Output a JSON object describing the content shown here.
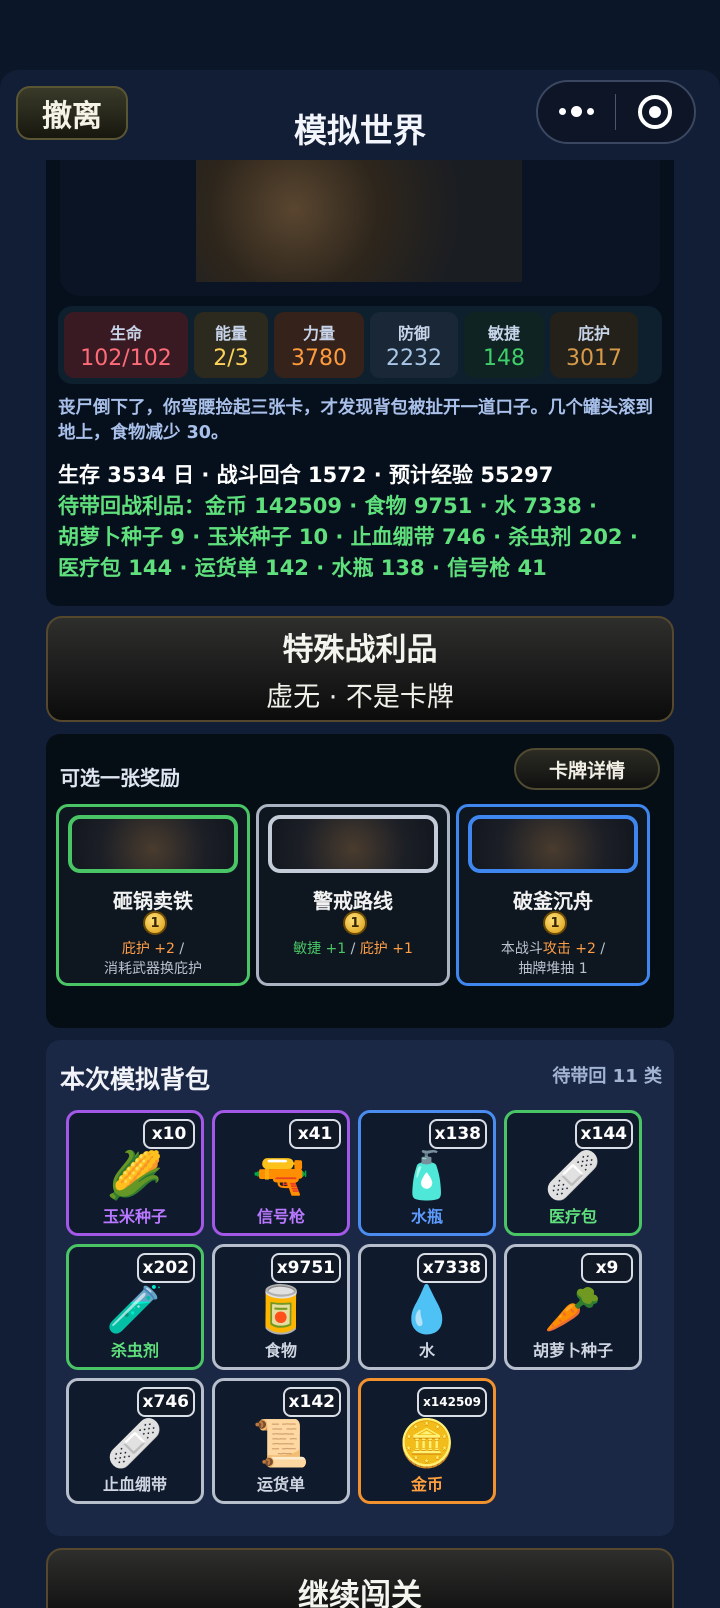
{
  "header": {
    "back_label": "撤离",
    "title": "模拟世界"
  },
  "stats": [
    {
      "label": "生命",
      "value": "102/102"
    },
    {
      "label": "能量",
      "value": "2/3"
    },
    {
      "label": "力量",
      "value": "3780"
    },
    {
      "label": "防御",
      "value": "2232"
    },
    {
      "label": "敏捷",
      "value": "148"
    },
    {
      "label": "庇护",
      "value": "3017"
    }
  ],
  "narration": "丧尸倒下了，你弯腰捡起三张卡，才发现背包被扯开一道口子。几个罐头滚到地上，食物减少 30。",
  "survival": {
    "summary": "生存 3534 日 · 战斗回合 1572 · 预计经验 55297",
    "loot_line1": "待带回战利品：金币 142509 · 食物 9751 · 水 7338 ·",
    "loot_line2": "胡萝卜种子 9 · 玉米种子 10 · 止血绷带 746 · 杀虫剂 202 ·",
    "loot_line3": "医疗包 144 · 运货单 142 · 水瓶 138 · 信号枪 41"
  },
  "special": {
    "title": "特殊战利品",
    "subtitle": "虚无 · 不是卡牌"
  },
  "rewards": {
    "title": "可选一张奖励",
    "detail_button": "卡牌详情",
    "cards": [
      {
        "name": "砸锅卖铁",
        "cost": "1",
        "desc_a": "庇护 +2",
        "desc_b": " / ",
        "desc_c": "消耗武器换庇护"
      },
      {
        "name": "警戒路线",
        "cost": "1",
        "desc_a": "敏捷 +1",
        "desc_b": " / ",
        "desc_c": "庇护 +1"
      },
      {
        "name": "破釜沉舟",
        "cost": "1",
        "desc_a": "本战斗",
        "desc_b": "攻击 +2",
        "desc_c": " / ",
        "desc_d": "抽牌堆抽 1"
      }
    ]
  },
  "bag": {
    "title": "本次模拟背包",
    "count": "待带回 11 类",
    "items": [
      {
        "name": "玉米种子",
        "qty": "x10",
        "icon": "corn-seed-bag-icon",
        "glyph": "🌽"
      },
      {
        "name": "信号枪",
        "qty": "x41",
        "icon": "flare-gun-icon",
        "glyph": "🔫"
      },
      {
        "name": "水瓶",
        "qty": "x138",
        "icon": "water-bottle-icon",
        "glyph": "🧴"
      },
      {
        "name": "医疗包",
        "qty": "x144",
        "icon": "medkit-icon",
        "glyph": "🩹"
      },
      {
        "name": "杀虫剂",
        "qty": "x202",
        "icon": "spray-bottle-icon",
        "glyph": "🧪"
      },
      {
        "name": "食物",
        "qty": "x9751",
        "icon": "canned-food-icon",
        "glyph": "🥫"
      },
      {
        "name": "水",
        "qty": "x7338",
        "icon": "water-drop-icon",
        "glyph": "💧"
      },
      {
        "name": "胡萝卜种子",
        "qty": "x9",
        "icon": "carrot-seed-bag-icon",
        "glyph": "🥕"
      },
      {
        "name": "止血绷带",
        "qty": "x746",
        "icon": "bandage-roll-icon",
        "glyph": "🩹"
      },
      {
        "name": "运货单",
        "qty": "x142",
        "icon": "waybill-scroll-icon",
        "glyph": "📜"
      },
      {
        "name": "金币",
        "qty": "x142509",
        "icon": "gold-coins-icon",
        "glyph": "🪙"
      }
    ]
  },
  "continue_label": "继续闯关",
  "colors": {
    "green_rarity": "#49c566",
    "purple_rarity": "#a458e8",
    "blue_rarity": "#4a8cf0",
    "orange_rarity": "#f2922e",
    "gray_rarity": "#b7bfcc"
  }
}
